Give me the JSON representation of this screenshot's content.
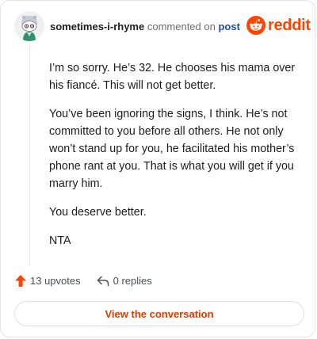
{
  "comment": {
    "username": "sometimes-i-rhyme",
    "action_text": "commented on",
    "post_link": "post",
    "brand": "reddit",
    "body": [
      "I’m so sorry. He’s 32. He chooses his mama over his fiancé. This will not get better.",
      "You’ve been ignoring the signs, I think. He’s not committed to you before all others. He not only won’t stand up for you, he facilitated his mother’s phone rant at you. That is what you will get if you marry him.",
      "You deserve better.",
      "NTA"
    ],
    "upvotes": "13 upvotes",
    "replies": "0 replies",
    "view_button": "View the conversation"
  },
  "colors": {
    "brand": "#ff4500",
    "upvote": "#ff4500",
    "link": "#1f4d99",
    "button_text": "#d93a00"
  },
  "icons": {
    "avatar": "snoo-avatar",
    "logo": "reddit-snoo-icon",
    "upvote": "upvote-arrow-icon",
    "reply": "reply-arrow-icon"
  }
}
